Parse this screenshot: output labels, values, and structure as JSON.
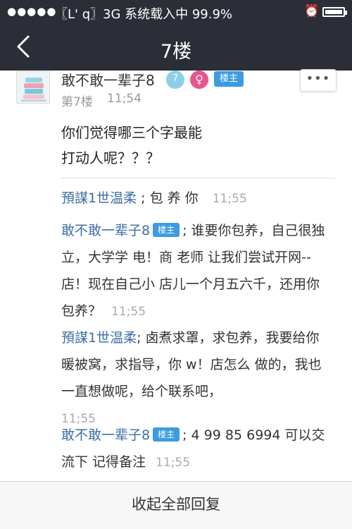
{
  "status_bar": {
    "signal_dots": "●●●●●",
    "carrier": "〖L' q〗",
    "network_status": "3G 系统载入中 99.9%",
    "alarm_icon": "alarm-icon",
    "battery_icon": "battery-icon"
  },
  "nav": {
    "back_icon": "chevron-left-icon",
    "title": "7楼"
  },
  "post": {
    "username": "敢不敢一辈子8",
    "level": "7",
    "gender_symbol": "♀",
    "owner_badge": "楼主",
    "more_label": "•••",
    "floor": "第7楼",
    "time": "11;54",
    "content_line1": "你们觉得哪三个字最能",
    "content_line2": "打动人呢？？？"
  },
  "replies": [
    {
      "name": "預謀1世温柔",
      "badge": "",
      "text": "; 包 养 你",
      "time": "11;55"
    },
    {
      "name": "敢不敢一辈子8",
      "badge": "楼主",
      "text": "; 谁要你包养，自己很独立，大学学 电！商 老师 让我们尝试开网--店！现在自己小 店儿一个月五六千，还用你包养？",
      "time": "11;55"
    },
    {
      "name": "預謀1世温柔",
      "badge": "",
      "text": "; 卤煮求罩，求包养，我要给你 暖被窝，求指导，你 w！店怎么 做的，我也一直想做呢，给个联系吧，",
      "time": "11;55"
    },
    {
      "name": "敢不敢一辈子8",
      "badge": "楼主",
      "text": "; 4 99 85 6994 可以交流下 记得备注",
      "time": "11;55"
    }
  ],
  "footer": {
    "collapse_label": "收起全部回复"
  },
  "colors": {
    "nav_bg": "#2b2e37",
    "link_blue": "#3c6ea5",
    "badge_blue": "#3d9be1",
    "gender_pink": "#e7568f",
    "level_blue": "#8ecfe8"
  }
}
